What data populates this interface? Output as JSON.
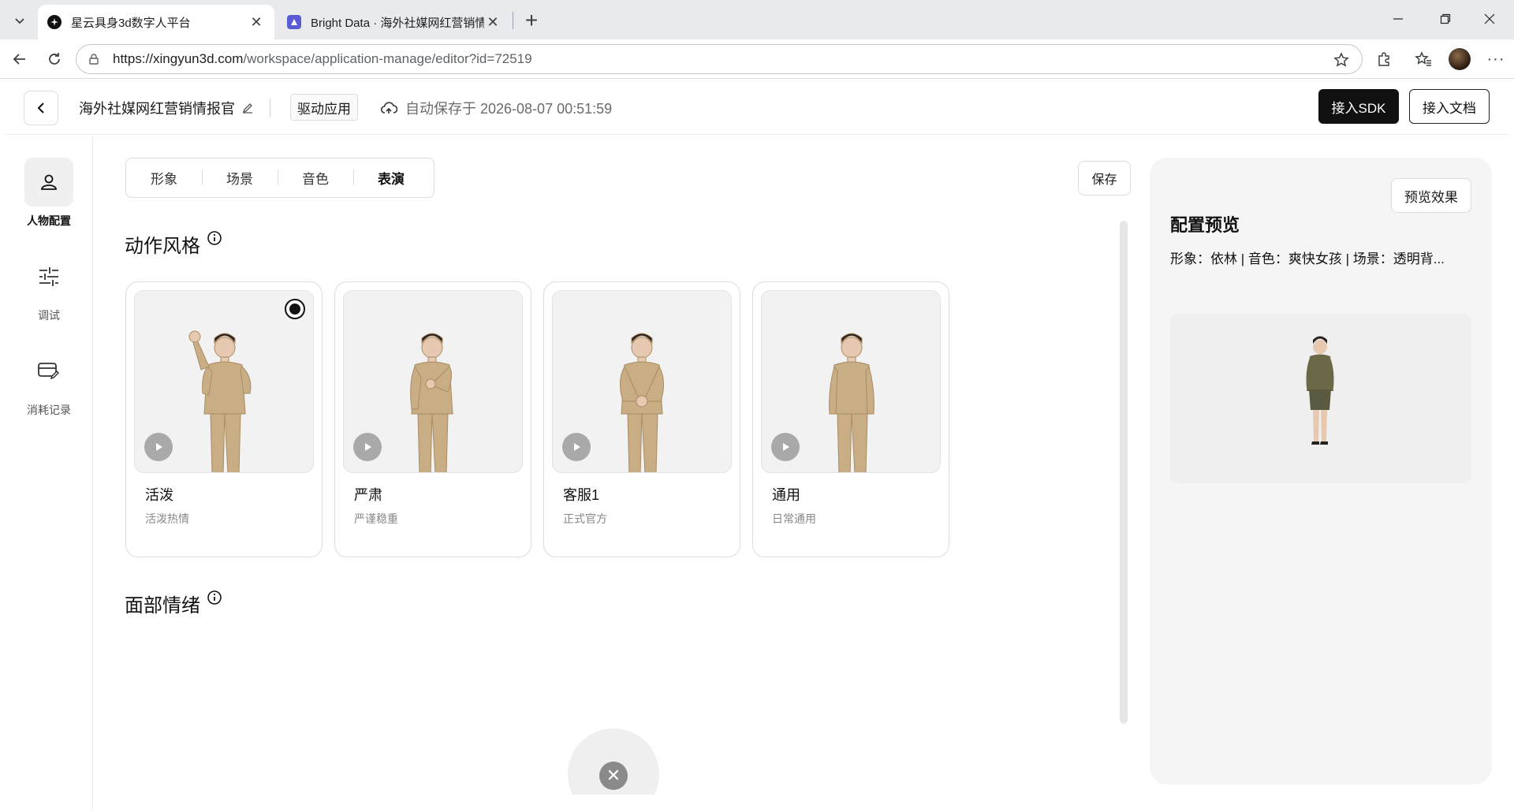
{
  "browser": {
    "tabs": [
      {
        "title": "星云具身3d数字人平台",
        "active": true
      },
      {
        "title": "Bright Data · 海外社媒网红营销情报",
        "active": false
      }
    ],
    "url_host": "https://xingyun3d.com",
    "url_path": "/workspace/application-manage/editor?id=72519"
  },
  "header": {
    "app_title": "海外社媒网红营销情报官",
    "drive_tag": "驱动应用",
    "autosave_text": "自动保存于 2026-08-07 00:51:59",
    "sdk_label": "接入SDK",
    "docs_label": "接入文档"
  },
  "leftnav": [
    {
      "label": "人物配置",
      "icon": "person-icon",
      "active": true
    },
    {
      "label": "调试",
      "icon": "sliders-icon",
      "active": false
    },
    {
      "label": "消耗记录",
      "icon": "card-edit-icon",
      "active": false
    }
  ],
  "main": {
    "tabs": [
      {
        "label": "形象",
        "active": false
      },
      {
        "label": "场景",
        "active": false
      },
      {
        "label": "音色",
        "active": false
      },
      {
        "label": "表演",
        "active": true
      }
    ],
    "save_label": "保存",
    "action_section_title": "动作风格",
    "face_section_title": "面部情绪",
    "styles": [
      {
        "name": "活泼",
        "desc": "活泼热情",
        "selected": true,
        "pose": "wave"
      },
      {
        "name": "严肃",
        "desc": "严谨稳重",
        "selected": false,
        "pose": "hand-chest"
      },
      {
        "name": "客服1",
        "desc": "正式官方",
        "selected": false,
        "pose": "hands-clasped"
      },
      {
        "name": "通用",
        "desc": "日常通用",
        "selected": false,
        "pose": "arms-down"
      }
    ]
  },
  "preview": {
    "button_label": "预览效果",
    "title": "配置预览",
    "meta": "形象：依林 | 音色：爽快女孩 | 场景：透明背..."
  },
  "colors": {
    "accent": "#111111",
    "suit": "#c9ad84",
    "preview_outfit": "#6b6848"
  }
}
